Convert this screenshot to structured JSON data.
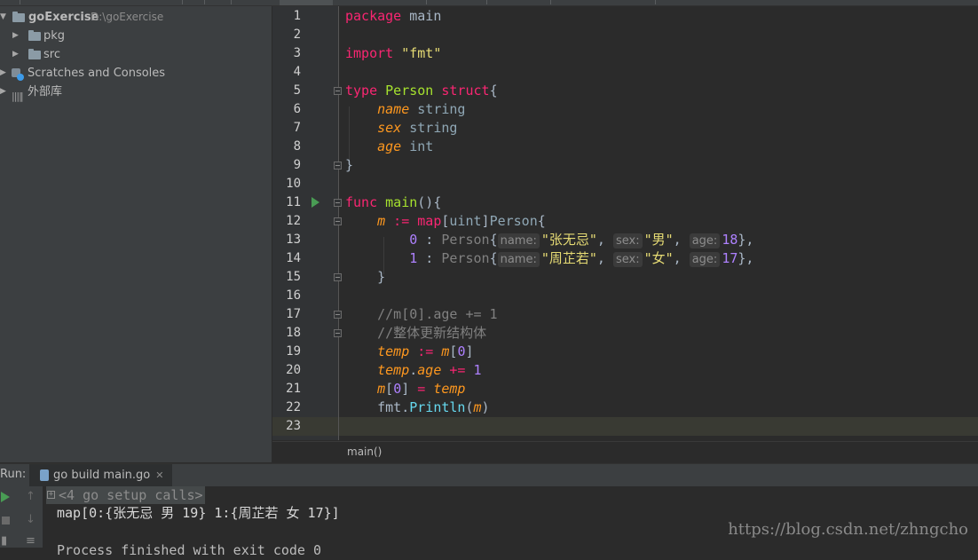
{
  "project": {
    "root_name": "goExercise",
    "root_path": "D:\\goExercise",
    "items": [
      {
        "label": "pkg"
      },
      {
        "label": "src"
      },
      {
        "label": "Scratches and Consoles"
      },
      {
        "label": "外部库"
      }
    ]
  },
  "editor": {
    "line_numbers": [
      "1",
      "2",
      "3",
      "4",
      "5",
      "6",
      "7",
      "8",
      "9",
      "10",
      "11",
      "12",
      "13",
      "14",
      "15",
      "16",
      "17",
      "18",
      "19",
      "20",
      "21",
      "22",
      "23"
    ],
    "breadcrumb": "main()",
    "code": {
      "l1_kw": "package",
      "l1_rest": " main",
      "l3_kw": "import",
      "l3_str": " \"fmt\"",
      "l5_kw": "type",
      "l5_name": " Person",
      "l5_kw2": " struct",
      "l5_brace": "{",
      "l6_field": "name",
      "l6_type": " string",
      "l7_field": "sex",
      "l7_type": " string",
      "l8_field": "age",
      "l8_type": " int",
      "l9": "}",
      "l11_kw": "func",
      "l11_fn": " main",
      "l11_rest": "(){",
      "l12_var": "m",
      "l12_op": " :=",
      "l12_map": " map",
      "l12_b1": "[",
      "l12_key": "uint",
      "l12_b2": "]",
      "l12_val": "Person",
      "l12_brace": "{",
      "l13_key": "0",
      "l13_colon": " : ",
      "l13_type": "Person",
      "l13_open": "{",
      "l13_h1": "name:",
      "l13_v1": "\"张无忌\"",
      "l13_c1": ", ",
      "l13_h2": "sex:",
      "l13_v2": "\"男\"",
      "l13_c2": ", ",
      "l13_h3": "age:",
      "l13_v3": "18",
      "l13_end": "},",
      "l14_key": "1",
      "l14_colon": " : ",
      "l14_type": "Person",
      "l14_open": "{",
      "l14_h1": "name:",
      "l14_v1": "\"周芷若\"",
      "l14_c1": ", ",
      "l14_h2": "sex:",
      "l14_v2": "\"女\"",
      "l14_c2": ", ",
      "l14_h3": "age:",
      "l14_v3": "17",
      "l14_end": "},",
      "l15": "}",
      "l17": "//m[0].age += 1",
      "l18": "//整体更新结构体",
      "l19_var": "temp",
      "l19_op": " :=",
      "l19_m": " m",
      "l19_b1": "[",
      "l19_idx": "0",
      "l19_b2": "]",
      "l20_var": "temp",
      "l20_dot": ".",
      "l20_field": "age",
      "l20_op": " +=",
      "l20_num": " 1",
      "l21_m": "m",
      "l21_b1": "[",
      "l21_idx": "0",
      "l21_b2": "]",
      "l21_op": " =",
      "l21_var": " temp",
      "l22_pkg": "fmt",
      "l22_dot": ".",
      "l22_fn": "Println",
      "l22_p1": "(",
      "l22_arg": "m",
      "l22_p2": ")"
    }
  },
  "run": {
    "label": "Run:",
    "tab_label": "go build main.go",
    "collapsed": "<4 go setup calls>",
    "output_line": "map[0:{张无忌 男 19} 1:{周芷若 女 17}]",
    "partial_line": "Process finished with exit code 0"
  },
  "watermark": "https://blog.csdn.net/zhngcho",
  "colors": {
    "keyword": "#f92672",
    "type": "#a6e22e",
    "field": "#fd971f",
    "string": "#e6db74",
    "number": "#ae81ff",
    "comment": "#808080",
    "background": "#2b2b2b"
  }
}
